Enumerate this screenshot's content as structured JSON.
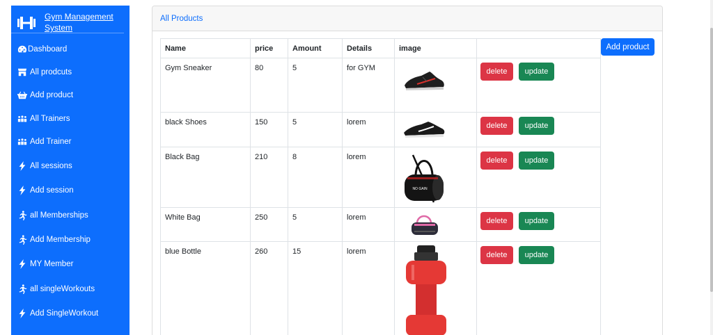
{
  "app": {
    "title": "Gym Management System"
  },
  "sidebar": {
    "items": [
      {
        "label": "Dashboard",
        "icon": "dashboard-icon"
      },
      {
        "label": "All prodcuts",
        "icon": "store-icon"
      },
      {
        "label": "Add product",
        "icon": "basket-icon"
      },
      {
        "label": "All Trainers",
        "icon": "people-icon"
      },
      {
        "label": "Add Trainer",
        "icon": "people-icon"
      },
      {
        "label": "All sessions",
        "icon": "bolt-icon"
      },
      {
        "label": "Add session",
        "icon": "bolt-icon"
      },
      {
        "label": "all Memberships",
        "icon": "running-icon"
      },
      {
        "label": "Add Membership",
        "icon": "running-icon"
      },
      {
        "label": "MY Member",
        "icon": "bolt-icon"
      },
      {
        "label": "all singleWorkouts",
        "icon": "running-icon"
      },
      {
        "label": "Add SingleWorkout",
        "icon": "bolt-icon"
      }
    ]
  },
  "card": {
    "header": "All Products"
  },
  "toolbar": {
    "add_label": "Add product"
  },
  "table": {
    "columns": [
      "Name",
      "price",
      "Amount",
      "Details",
      "image",
      ""
    ],
    "rows": [
      {
        "name": "Gym Sneaker",
        "price": "80",
        "amount": "5",
        "details": "for GYM",
        "image": "sneaker-image"
      },
      {
        "name": "black Shoes",
        "price": "150",
        "amount": "5",
        "details": "lorem",
        "image": "shoe-image"
      },
      {
        "name": "Black Bag",
        "price": "210",
        "amount": "8",
        "details": "lorem",
        "image": "black-bag-image"
      },
      {
        "name": "White Bag",
        "price": "250",
        "amount": "5",
        "details": "lorem",
        "image": "white-bag-image"
      },
      {
        "name": "blue Bottle",
        "price": "260",
        "amount": "15",
        "details": "lorem",
        "image": "bottle-image"
      }
    ],
    "delete_label": "delete",
    "update_label": "update"
  },
  "colors": {
    "primary": "#0d6efd",
    "danger": "#dc3545",
    "success": "#198754"
  }
}
